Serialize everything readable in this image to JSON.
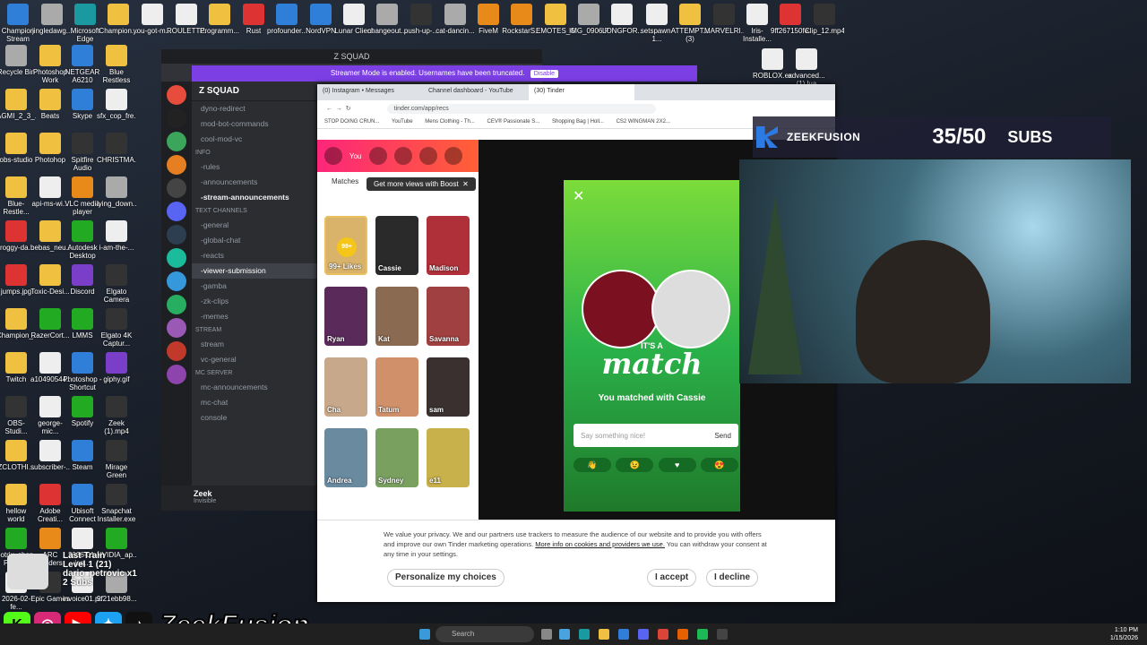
{
  "desktop_icons": [
    {
      "label": "Champion Stream Ov...",
      "color": "blue"
    },
    {
      "label": "jingledawg...",
      "color": "gray"
    },
    {
      "label": "Microsoft Edge",
      "color": "teal"
    },
    {
      "label": "Champion...",
      "color": "folder"
    },
    {
      "label": "you-got-m...",
      "color": "white"
    },
    {
      "label": "ROULETTE.txt",
      "color": "white"
    },
    {
      "label": "Programm...",
      "color": "folder"
    },
    {
      "label": "Rust",
      "color": "red"
    },
    {
      "label": "profounder...",
      "color": "blue"
    },
    {
      "label": "NordVPN",
      "color": "blue"
    },
    {
      "label": "Lunar Client",
      "color": "white"
    },
    {
      "label": "changeout...",
      "color": "gray"
    },
    {
      "label": "push-up-...",
      "color": "dark"
    },
    {
      "label": "cat-dancin...",
      "color": "gray"
    },
    {
      "label": "FiveM",
      "color": "orange"
    },
    {
      "label": "RockstarS...",
      "color": "orange"
    },
    {
      "label": "EMOTES_G...",
      "color": "folder"
    },
    {
      "label": "IMG_0906.P...",
      "color": "gray"
    },
    {
      "label": "LONGFOR...",
      "color": "white"
    },
    {
      "label": "setspawn-1...",
      "color": "white"
    },
    {
      "label": "ATTEMPT... (3)",
      "color": "folder"
    },
    {
      "label": "MARVELRI...",
      "color": "dark"
    },
    {
      "label": "Iris-Installe...",
      "color": "white"
    },
    {
      "label": "9ff267150fe...",
      "color": "red"
    },
    {
      "label": "Clip_12.mp4",
      "color": "dark"
    },
    {
      "label": "Recycle Bin",
      "color": "gray"
    },
    {
      "label": "Photoshop Work",
      "color": "folder"
    },
    {
      "label": "NETGEAR A6210 Genie",
      "color": "blue"
    },
    {
      "label": "Blue Restless",
      "color": "folder"
    },
    {
      "label": "AGMI_2_3_...",
      "color": "folder"
    },
    {
      "label": "Beats",
      "color": "folder"
    },
    {
      "label": "Skype",
      "color": "blue"
    },
    {
      "label": "sfx_cop_fre...",
      "color": "white"
    },
    {
      "label": "obs-studio",
      "color": "folder"
    },
    {
      "label": "Photohop",
      "color": "folder"
    },
    {
      "label": "Spitfire Audio",
      "color": "dark"
    },
    {
      "label": "CHRISTMA...",
      "color": "dark"
    },
    {
      "label": "Blue-Restle...",
      "color": "folder"
    },
    {
      "label": "api-ms-wi...",
      "color": "white"
    },
    {
      "label": "VLC media player",
      "color": "orange"
    },
    {
      "label": "lying_down...",
      "color": "gray"
    },
    {
      "label": "froggy-da...",
      "color": "red"
    },
    {
      "label": "bebas_neu...",
      "color": "folder"
    },
    {
      "label": "Autodesk Desktop App",
      "color": "green"
    },
    {
      "label": "i-am-the-...",
      "color": "white"
    },
    {
      "label": "jumps.jpg",
      "color": "red"
    },
    {
      "label": "Toxic-Desi...",
      "color": "folder"
    },
    {
      "label": "Discord",
      "color": "purple"
    },
    {
      "label": "Elgato Camera Hub",
      "color": "dark"
    },
    {
      "label": "Champion_...",
      "color": "folder"
    },
    {
      "label": "RazerCort...",
      "color": "green"
    },
    {
      "label": "LMMS",
      "color": "green"
    },
    {
      "label": "Elgato 4K Captur...",
      "color": "dark"
    },
    {
      "label": "Twitch",
      "color": "folder"
    },
    {
      "label": "a10490544...",
      "color": "white"
    },
    {
      "label": "Photoshop - Shortcut",
      "color": "blue"
    },
    {
      "label": "giphy.gif",
      "color": "purple"
    },
    {
      "label": "OBS-Studi...",
      "color": "dark"
    },
    {
      "label": "george-mic...",
      "color": "white"
    },
    {
      "label": "Spotify",
      "color": "green"
    },
    {
      "label": "Zeek (1).mp4",
      "color": "dark"
    },
    {
      "label": "ZCLOTHI...",
      "color": "folder"
    },
    {
      "label": "subscriber-...",
      "color": "white"
    },
    {
      "label": "Steam",
      "color": "blue"
    },
    {
      "label": "Mirage Green Gaming St...",
      "color": "dark"
    },
    {
      "label": "hellow world",
      "color": "folder"
    },
    {
      "label": "Adobe Creati...",
      "color": "red"
    },
    {
      "label": "Ubisoft Connect",
      "color": "blue"
    },
    {
      "label": "Snapchat Installer.exe",
      "color": "dark"
    },
    {
      "label": "botrix_shop... PM.xlsx",
      "color": "green"
    },
    {
      "label": "ARC Raiders",
      "color": "orange"
    },
    {
      "label": "2026-01-jan...",
      "color": "white"
    },
    {
      "label": "NVIDIA_ap...",
      "color": "green"
    },
    {
      "label": "2026-02-fe...",
      "color": "white"
    },
    {
      "label": "Epic Games",
      "color": "dark"
    },
    {
      "label": "invoice01.pdf",
      "color": "white"
    },
    {
      "label": "9f21ebb98...",
      "color": "gray"
    },
    {
      "label": "botrix_shop... PM.pdf",
      "color": "red"
    },
    {
      "label": "NVIDIA App",
      "color": "green"
    },
    {
      "label": "ROBLOX.exe",
      "color": "white"
    },
    {
      "label": "advanced... (1).lua",
      "color": "white"
    }
  ],
  "discord": {
    "window_title": "Z SQUAD",
    "banner_text": "Streamer Mode is enabled. Usernames have been truncated.",
    "banner_button": "Disable",
    "server_name": "Z SQUAD",
    "channels_top": [
      "dyno-redirect",
      "mod-bot-commands",
      "cool-mod-vc"
    ],
    "category_info": "Info",
    "channels_info": [
      "-rules",
      "-announcements",
      "-stream-announcements"
    ],
    "category_text": "Text Channels",
    "channels_text": [
      "-general",
      "-global-chat",
      "-reacts",
      "-viewer-submission",
      "-gamba",
      "-zk-clips",
      "-memes"
    ],
    "category_stream": "STREAM",
    "channels_stream": [
      "stream",
      "vc-general"
    ],
    "category_mc": "MC SERVER",
    "channels_mc": [
      "mc-announcements",
      "mc-chat",
      "console"
    ],
    "username": "Zeek",
    "user_status": "Invisible"
  },
  "chrome": {
    "tabs": [
      "(0) Instagram • Messages",
      "Channel dashboard - YouTube",
      "(30) Tinder"
    ],
    "url": "tinder.com/app/recs",
    "bookmarks": [
      "STOP DOING CRUN...",
      "YouTube",
      "Mens Clothing - Th...",
      "CEV® Passionate S...",
      "Shopping Bag | Holl...",
      "CS2 WINGMAN 2X2..."
    ]
  },
  "tinder": {
    "you_label": "You",
    "matches_tab": "Matches",
    "boost_tooltip": "Get more views with Boost",
    "likes_label": "99+ Likes",
    "likes_badge": "99+",
    "matches": [
      "Cassie",
      "Madison",
      "Ryan",
      "Kat",
      "Savanna",
      "Cha",
      "Tatum",
      "sam",
      "Andrea",
      "Sydney",
      "e11"
    ],
    "match_its_a": "IT'S A",
    "match_word": "match",
    "match_subtitle": "You matched with Cassie",
    "message_placeholder": "Say something nice!",
    "send_label": "Send",
    "quick_reactions": [
      "👋",
      "😉",
      "♥",
      "😍"
    ],
    "cookie_text": "We value your privacy. We and our partners use trackers to measure the audience of our website and to provide you with offers and improve our own Tinder marketing operations.",
    "cookie_link": "More info on cookies and providers we use.",
    "cookie_text2": "You can withdraw your consent at any time in your settings.",
    "personalize_button": "Personalize my choices",
    "accept_button": "I accept",
    "decline_button": "I decline"
  },
  "stream_overlay": {
    "channel_name": "ZEEKFUSION",
    "sub_count": "35/50",
    "subs_label": "SUBS",
    "latest_train_label": "Last Train",
    "level_text": "Level 1 (21)",
    "latest_user": "dario_petrovic x1",
    "subs_text": "2 Subs",
    "brand_name": "ZeekFusion"
  },
  "taskbar": {
    "search_placeholder": "Search",
    "time": "1:10 PM",
    "date": "1/15/2026"
  }
}
